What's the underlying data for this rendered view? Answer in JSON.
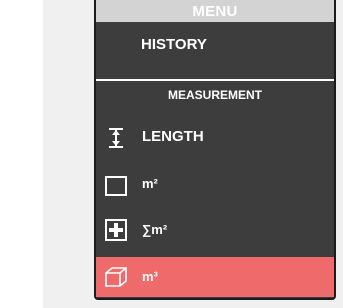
{
  "menu": {
    "title": "MENU",
    "history_label": "HISTORY",
    "section_title": "MEASUREMENT",
    "items": [
      {
        "label": "LENGTH",
        "icon": "length-icon"
      },
      {
        "label": "m²",
        "icon": "square-icon"
      },
      {
        "label": "∑m²",
        "icon": "sum-area-icon"
      },
      {
        "label": "m³",
        "icon": "cube-icon",
        "selected": true
      }
    ],
    "colors": {
      "background": "#3d3d3d",
      "selected": "#ef6b6b",
      "title_bar": "#d3d3d3"
    }
  }
}
